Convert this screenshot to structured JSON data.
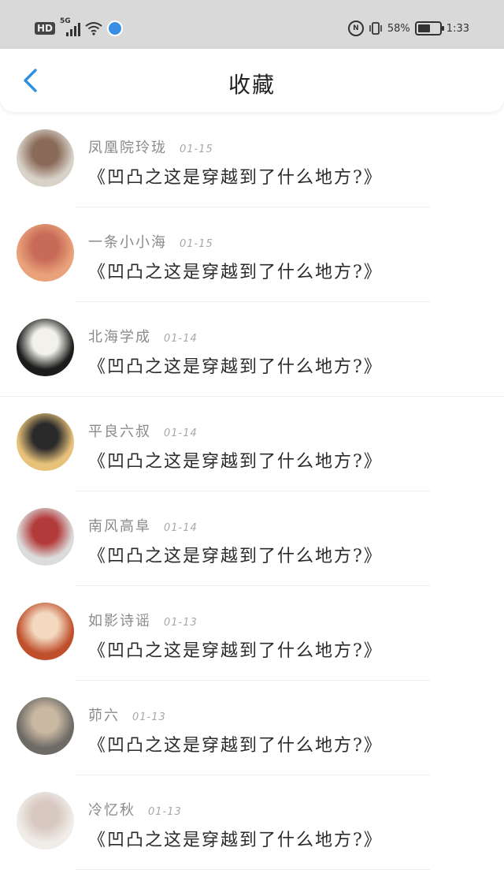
{
  "status_bar": {
    "hd": "HD",
    "network": "5G",
    "nfc": "N",
    "battery_text": "58%",
    "battery_level": 0.58,
    "time": "1:33"
  },
  "nav": {
    "back_icon": "chevron-left-icon",
    "title": "收藏",
    "accent": "#2f8fe0"
  },
  "items": [
    {
      "name": "凤凰院玲珑",
      "date": "01-15",
      "message": "《凹凸之这是穿越到了什么地方?》",
      "avatar_colors": [
        "#d8d2c8",
        "#8a6a58"
      ]
    },
    {
      "name": "一条小小海",
      "date": "01-15",
      "message": "《凹凸之这是穿越到了什么地方?》",
      "avatar_colors": [
        "#e9a27a",
        "#c86a58"
      ]
    },
    {
      "name": "北海学成",
      "date": "01-14",
      "message": "《凹凸之这是穿越到了什么地方?》",
      "avatar_colors": [
        "#1c1c1c",
        "#f2f2ea"
      ]
    },
    {
      "name": "平良六叔",
      "date": "01-14",
      "message": "《凹凸之这是穿越到了什么地方?》",
      "avatar_colors": [
        "#e8c27a",
        "#2a2a2a"
      ]
    },
    {
      "name": "南风高阜",
      "date": "01-14",
      "message": "《凹凸之这是穿越到了什么地方?》",
      "avatar_colors": [
        "#dcdcdc",
        "#b33a3a"
      ]
    },
    {
      "name": "如影诗谣",
      "date": "01-13",
      "message": "《凹凸之这是穿越到了什么地方?》",
      "avatar_colors": [
        "#c0502c",
        "#f3d9c0"
      ]
    },
    {
      "name": "茆六",
      "date": "01-13",
      "message": "《凹凸之这是穿越到了什么地方?》",
      "avatar_colors": [
        "#6e6a66",
        "#c9b8a2"
      ]
    },
    {
      "name": "冷忆秋",
      "date": "01-13",
      "message": "《凹凸之这是穿越到了什么地方?》",
      "avatar_colors": [
        "#f0ece8",
        "#d7c8c0"
      ]
    }
  ]
}
